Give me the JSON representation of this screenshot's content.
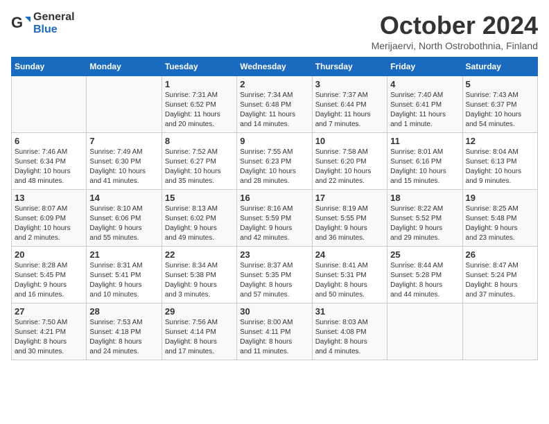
{
  "header": {
    "logo_general": "General",
    "logo_blue": "Blue",
    "month": "October 2024",
    "location": "Merijaervi, North Ostrobothnia, Finland"
  },
  "days_of_week": [
    "Sunday",
    "Monday",
    "Tuesday",
    "Wednesday",
    "Thursday",
    "Friday",
    "Saturday"
  ],
  "weeks": [
    [
      {
        "day": "",
        "content": ""
      },
      {
        "day": "",
        "content": ""
      },
      {
        "day": "1",
        "content": "Sunrise: 7:31 AM\nSunset: 6:52 PM\nDaylight: 11 hours\nand 20 minutes."
      },
      {
        "day": "2",
        "content": "Sunrise: 7:34 AM\nSunset: 6:48 PM\nDaylight: 11 hours\nand 14 minutes."
      },
      {
        "day": "3",
        "content": "Sunrise: 7:37 AM\nSunset: 6:44 PM\nDaylight: 11 hours\nand 7 minutes."
      },
      {
        "day": "4",
        "content": "Sunrise: 7:40 AM\nSunset: 6:41 PM\nDaylight: 11 hours\nand 1 minute."
      },
      {
        "day": "5",
        "content": "Sunrise: 7:43 AM\nSunset: 6:37 PM\nDaylight: 10 hours\nand 54 minutes."
      }
    ],
    [
      {
        "day": "6",
        "content": "Sunrise: 7:46 AM\nSunset: 6:34 PM\nDaylight: 10 hours\nand 48 minutes."
      },
      {
        "day": "7",
        "content": "Sunrise: 7:49 AM\nSunset: 6:30 PM\nDaylight: 10 hours\nand 41 minutes."
      },
      {
        "day": "8",
        "content": "Sunrise: 7:52 AM\nSunset: 6:27 PM\nDaylight: 10 hours\nand 35 minutes."
      },
      {
        "day": "9",
        "content": "Sunrise: 7:55 AM\nSunset: 6:23 PM\nDaylight: 10 hours\nand 28 minutes."
      },
      {
        "day": "10",
        "content": "Sunrise: 7:58 AM\nSunset: 6:20 PM\nDaylight: 10 hours\nand 22 minutes."
      },
      {
        "day": "11",
        "content": "Sunrise: 8:01 AM\nSunset: 6:16 PM\nDaylight: 10 hours\nand 15 minutes."
      },
      {
        "day": "12",
        "content": "Sunrise: 8:04 AM\nSunset: 6:13 PM\nDaylight: 10 hours\nand 9 minutes."
      }
    ],
    [
      {
        "day": "13",
        "content": "Sunrise: 8:07 AM\nSunset: 6:09 PM\nDaylight: 10 hours\nand 2 minutes."
      },
      {
        "day": "14",
        "content": "Sunrise: 8:10 AM\nSunset: 6:06 PM\nDaylight: 9 hours\nand 55 minutes."
      },
      {
        "day": "15",
        "content": "Sunrise: 8:13 AM\nSunset: 6:02 PM\nDaylight: 9 hours\nand 49 minutes."
      },
      {
        "day": "16",
        "content": "Sunrise: 8:16 AM\nSunset: 5:59 PM\nDaylight: 9 hours\nand 42 minutes."
      },
      {
        "day": "17",
        "content": "Sunrise: 8:19 AM\nSunset: 5:55 PM\nDaylight: 9 hours\nand 36 minutes."
      },
      {
        "day": "18",
        "content": "Sunrise: 8:22 AM\nSunset: 5:52 PM\nDaylight: 9 hours\nand 29 minutes."
      },
      {
        "day": "19",
        "content": "Sunrise: 8:25 AM\nSunset: 5:48 PM\nDaylight: 9 hours\nand 23 minutes."
      }
    ],
    [
      {
        "day": "20",
        "content": "Sunrise: 8:28 AM\nSunset: 5:45 PM\nDaylight: 9 hours\nand 16 minutes."
      },
      {
        "day": "21",
        "content": "Sunrise: 8:31 AM\nSunset: 5:41 PM\nDaylight: 9 hours\nand 10 minutes."
      },
      {
        "day": "22",
        "content": "Sunrise: 8:34 AM\nSunset: 5:38 PM\nDaylight: 9 hours\nand 3 minutes."
      },
      {
        "day": "23",
        "content": "Sunrise: 8:37 AM\nSunset: 5:35 PM\nDaylight: 8 hours\nand 57 minutes."
      },
      {
        "day": "24",
        "content": "Sunrise: 8:41 AM\nSunset: 5:31 PM\nDaylight: 8 hours\nand 50 minutes."
      },
      {
        "day": "25",
        "content": "Sunrise: 8:44 AM\nSunset: 5:28 PM\nDaylight: 8 hours\nand 44 minutes."
      },
      {
        "day": "26",
        "content": "Sunrise: 8:47 AM\nSunset: 5:24 PM\nDaylight: 8 hours\nand 37 minutes."
      }
    ],
    [
      {
        "day": "27",
        "content": "Sunrise: 7:50 AM\nSunset: 4:21 PM\nDaylight: 8 hours\nand 30 minutes."
      },
      {
        "day": "28",
        "content": "Sunrise: 7:53 AM\nSunset: 4:18 PM\nDaylight: 8 hours\nand 24 minutes."
      },
      {
        "day": "29",
        "content": "Sunrise: 7:56 AM\nSunset: 4:14 PM\nDaylight: 8 hours\nand 17 minutes."
      },
      {
        "day": "30",
        "content": "Sunrise: 8:00 AM\nSunset: 4:11 PM\nDaylight: 8 hours\nand 11 minutes."
      },
      {
        "day": "31",
        "content": "Sunrise: 8:03 AM\nSunset: 4:08 PM\nDaylight: 8 hours\nand 4 minutes."
      },
      {
        "day": "",
        "content": ""
      },
      {
        "day": "",
        "content": ""
      }
    ]
  ]
}
